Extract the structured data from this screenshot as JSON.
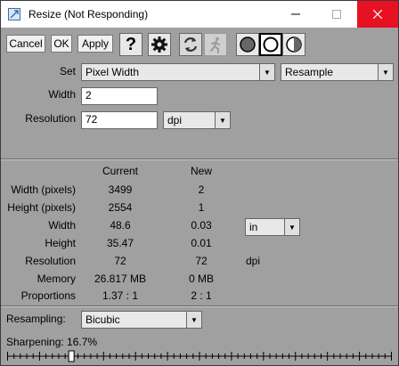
{
  "window": {
    "title": "Resize (Not Responding)"
  },
  "toolbar": {
    "cancel_label": "Cancel",
    "ok_label": "OK",
    "apply_label": "Apply",
    "help_icon": "question-icon",
    "settings_icon": "gear-icon",
    "refresh_icon": "refresh-icon",
    "run_icon": "running-figure-icon",
    "mode_icons": [
      "circle-filled-icon",
      "circle-open-icon",
      "circle-half-icon"
    ]
  },
  "form": {
    "set_label": "Set",
    "set_value": "Pixel Width",
    "method_value": "Resample",
    "width_label": "Width",
    "width_value": "2",
    "resolution_label": "Resolution",
    "resolution_value": "72",
    "resolution_unit": "dpi"
  },
  "stats": {
    "header_current": "Current",
    "header_new": "New",
    "rows": [
      {
        "label": "Width (pixels)",
        "current": "3499",
        "new": "2",
        "unit": ""
      },
      {
        "label": "Height (pixels)",
        "current": "2554",
        "new": "1",
        "unit": ""
      },
      {
        "label": "Width",
        "current": "48.6",
        "new": "0.03",
        "unit": ""
      },
      {
        "label": "Height",
        "current": "35.47",
        "new": "0.01",
        "unit": ""
      },
      {
        "label": "Resolution",
        "current": "72",
        "new": "72",
        "unit": "dpi"
      },
      {
        "label": "Memory",
        "current": "26.817 MB",
        "new": "0 MB",
        "unit": ""
      },
      {
        "label": "Proportions",
        "current": "1.37 : 1",
        "new": "2 : 1",
        "unit": ""
      }
    ],
    "size_unit": "in"
  },
  "resampling": {
    "label": "Resampling:",
    "value": "Bicubic",
    "sharpening_label": "Sharpening: 16.7%",
    "sharpening_fraction": 0.167
  },
  "colors": {
    "close": "#e81123",
    "background": "#a0a0a0"
  }
}
